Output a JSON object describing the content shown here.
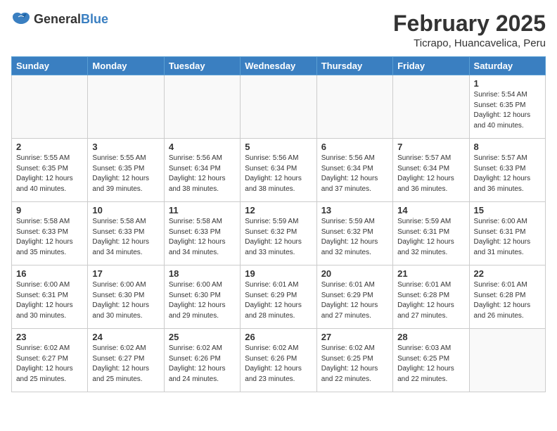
{
  "logo": {
    "general": "General",
    "blue": "Blue"
  },
  "header": {
    "month": "February 2025",
    "location": "Ticrapo, Huancavelica, Peru"
  },
  "weekdays": [
    "Sunday",
    "Monday",
    "Tuesday",
    "Wednesday",
    "Thursday",
    "Friday",
    "Saturday"
  ],
  "weeks": [
    [
      {
        "day": "",
        "info": ""
      },
      {
        "day": "",
        "info": ""
      },
      {
        "day": "",
        "info": ""
      },
      {
        "day": "",
        "info": ""
      },
      {
        "day": "",
        "info": ""
      },
      {
        "day": "",
        "info": ""
      },
      {
        "day": "1",
        "info": "Sunrise: 5:54 AM\nSunset: 6:35 PM\nDaylight: 12 hours\nand 40 minutes."
      }
    ],
    [
      {
        "day": "2",
        "info": "Sunrise: 5:55 AM\nSunset: 6:35 PM\nDaylight: 12 hours\nand 40 minutes."
      },
      {
        "day": "3",
        "info": "Sunrise: 5:55 AM\nSunset: 6:35 PM\nDaylight: 12 hours\nand 39 minutes."
      },
      {
        "day": "4",
        "info": "Sunrise: 5:56 AM\nSunset: 6:34 PM\nDaylight: 12 hours\nand 38 minutes."
      },
      {
        "day": "5",
        "info": "Sunrise: 5:56 AM\nSunset: 6:34 PM\nDaylight: 12 hours\nand 38 minutes."
      },
      {
        "day": "6",
        "info": "Sunrise: 5:56 AM\nSunset: 6:34 PM\nDaylight: 12 hours\nand 37 minutes."
      },
      {
        "day": "7",
        "info": "Sunrise: 5:57 AM\nSunset: 6:34 PM\nDaylight: 12 hours\nand 36 minutes."
      },
      {
        "day": "8",
        "info": "Sunrise: 5:57 AM\nSunset: 6:33 PM\nDaylight: 12 hours\nand 36 minutes."
      }
    ],
    [
      {
        "day": "9",
        "info": "Sunrise: 5:58 AM\nSunset: 6:33 PM\nDaylight: 12 hours\nand 35 minutes."
      },
      {
        "day": "10",
        "info": "Sunrise: 5:58 AM\nSunset: 6:33 PM\nDaylight: 12 hours\nand 34 minutes."
      },
      {
        "day": "11",
        "info": "Sunrise: 5:58 AM\nSunset: 6:33 PM\nDaylight: 12 hours\nand 34 minutes."
      },
      {
        "day": "12",
        "info": "Sunrise: 5:59 AM\nSunset: 6:32 PM\nDaylight: 12 hours\nand 33 minutes."
      },
      {
        "day": "13",
        "info": "Sunrise: 5:59 AM\nSunset: 6:32 PM\nDaylight: 12 hours\nand 32 minutes."
      },
      {
        "day": "14",
        "info": "Sunrise: 5:59 AM\nSunset: 6:31 PM\nDaylight: 12 hours\nand 32 minutes."
      },
      {
        "day": "15",
        "info": "Sunrise: 6:00 AM\nSunset: 6:31 PM\nDaylight: 12 hours\nand 31 minutes."
      }
    ],
    [
      {
        "day": "16",
        "info": "Sunrise: 6:00 AM\nSunset: 6:31 PM\nDaylight: 12 hours\nand 30 minutes."
      },
      {
        "day": "17",
        "info": "Sunrise: 6:00 AM\nSunset: 6:30 PM\nDaylight: 12 hours\nand 30 minutes."
      },
      {
        "day": "18",
        "info": "Sunrise: 6:00 AM\nSunset: 6:30 PM\nDaylight: 12 hours\nand 29 minutes."
      },
      {
        "day": "19",
        "info": "Sunrise: 6:01 AM\nSunset: 6:29 PM\nDaylight: 12 hours\nand 28 minutes."
      },
      {
        "day": "20",
        "info": "Sunrise: 6:01 AM\nSunset: 6:29 PM\nDaylight: 12 hours\nand 27 minutes."
      },
      {
        "day": "21",
        "info": "Sunrise: 6:01 AM\nSunset: 6:28 PM\nDaylight: 12 hours\nand 27 minutes."
      },
      {
        "day": "22",
        "info": "Sunrise: 6:01 AM\nSunset: 6:28 PM\nDaylight: 12 hours\nand 26 minutes."
      }
    ],
    [
      {
        "day": "23",
        "info": "Sunrise: 6:02 AM\nSunset: 6:27 PM\nDaylight: 12 hours\nand 25 minutes."
      },
      {
        "day": "24",
        "info": "Sunrise: 6:02 AM\nSunset: 6:27 PM\nDaylight: 12 hours\nand 25 minutes."
      },
      {
        "day": "25",
        "info": "Sunrise: 6:02 AM\nSunset: 6:26 PM\nDaylight: 12 hours\nand 24 minutes."
      },
      {
        "day": "26",
        "info": "Sunrise: 6:02 AM\nSunset: 6:26 PM\nDaylight: 12 hours\nand 23 minutes."
      },
      {
        "day": "27",
        "info": "Sunrise: 6:02 AM\nSunset: 6:25 PM\nDaylight: 12 hours\nand 22 minutes."
      },
      {
        "day": "28",
        "info": "Sunrise: 6:03 AM\nSunset: 6:25 PM\nDaylight: 12 hours\nand 22 minutes."
      },
      {
        "day": "",
        "info": ""
      }
    ]
  ]
}
